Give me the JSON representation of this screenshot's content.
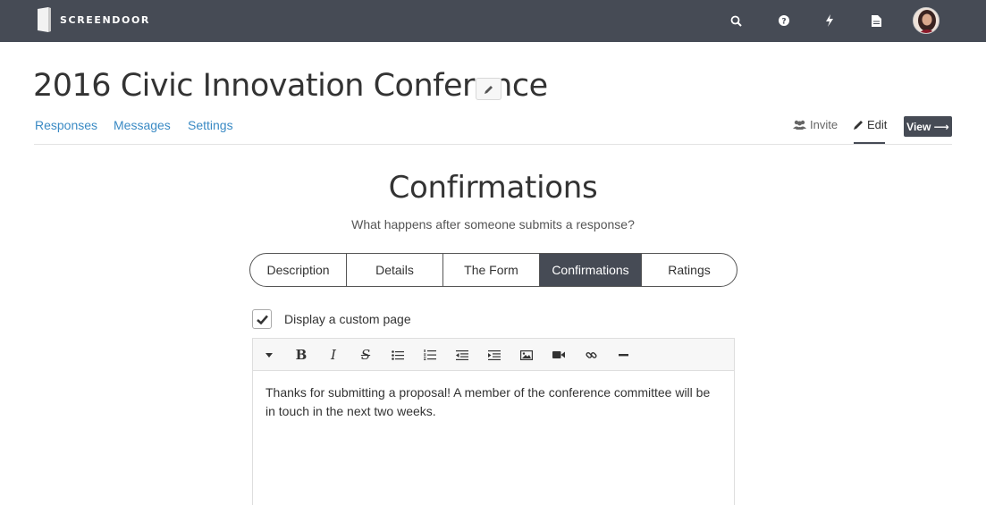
{
  "app": {
    "name": "SCREENDOOR"
  },
  "header": {
    "icons": [
      "search-icon",
      "help-icon",
      "bolt-icon",
      "document-icon"
    ]
  },
  "project": {
    "title": "2016 Civic Innovation Conference"
  },
  "subnav": {
    "links": [
      "Responses",
      "Messages",
      "Settings"
    ],
    "invite": "Invite",
    "edit": "Edit",
    "view": "View ⟶"
  },
  "section": {
    "title": "Confirmations",
    "subtitle": "What happens after someone submits a response?"
  },
  "tabs": [
    {
      "label": "Description"
    },
    {
      "label": "Details"
    },
    {
      "label": "The Form"
    },
    {
      "label": "Confirmations",
      "active": true
    },
    {
      "label": "Ratings"
    }
  ],
  "custom_page": {
    "checked": true,
    "label": "Display a custom page"
  },
  "editor": {
    "toolbar": [
      "dropdown-caret-icon",
      "bold-icon",
      "italic-icon",
      "strikethrough-icon",
      "bullet-list-icon",
      "numbered-list-icon",
      "outdent-icon",
      "indent-icon",
      "image-icon",
      "video-icon",
      "link-icon",
      "horizontal-rule-icon"
    ],
    "bold_glyph": "B",
    "italic_glyph": "I",
    "strike_glyph": "S",
    "content": "Thanks for submitting a proposal! A member of the conference committee will be in touch in the next two weeks."
  },
  "colors": {
    "topbar": "#464b55",
    "link": "#3a8ac4",
    "active_tab": "#464b55"
  }
}
